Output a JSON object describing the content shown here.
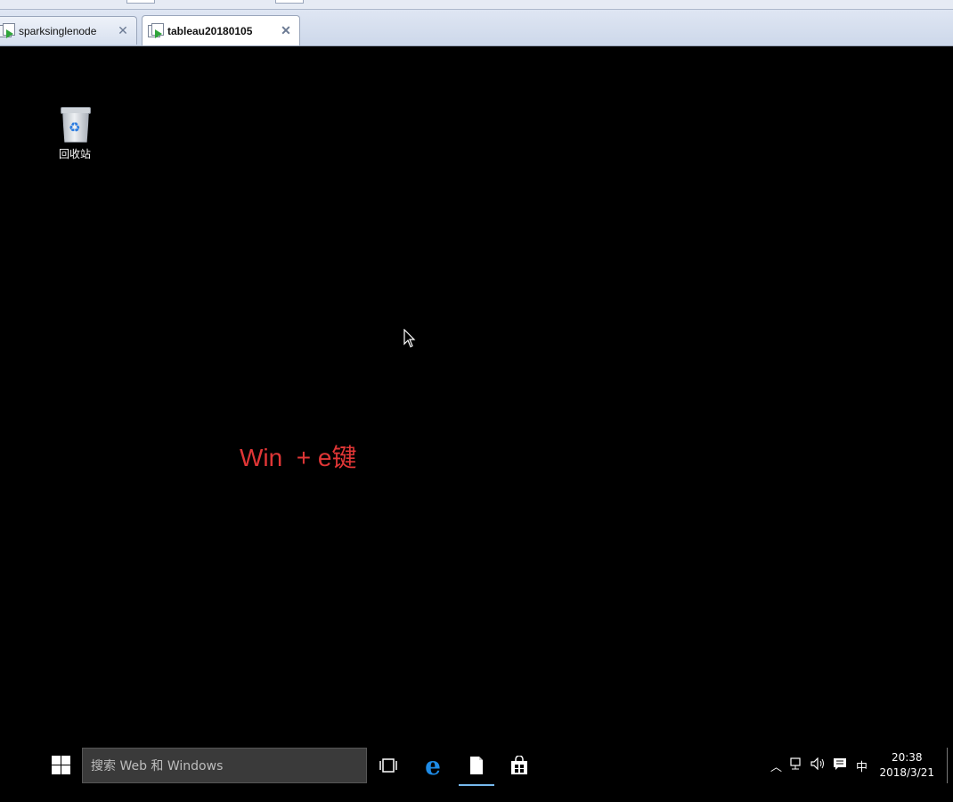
{
  "vm_tabs": [
    {
      "label": "sparksinglenode",
      "active": false
    },
    {
      "label": "tableau20180105",
      "active": true
    }
  ],
  "desktop": {
    "recycle_bin_label": "回收站",
    "annotation": "Win  + e键",
    "annotation_color": "#e03636"
  },
  "taskbar": {
    "search_placeholder": "搜索 Web 和 Windows",
    "input_method": "中",
    "clock_time": "20:38",
    "clock_date": "2018/3/21"
  },
  "icons": [
    "windows-start-icon",
    "task-view-icon",
    "edge-icon",
    "file-explorer-icon",
    "store-icon",
    "tray-chevron-icon",
    "network-icon",
    "volume-icon",
    "action-center-icon"
  ]
}
